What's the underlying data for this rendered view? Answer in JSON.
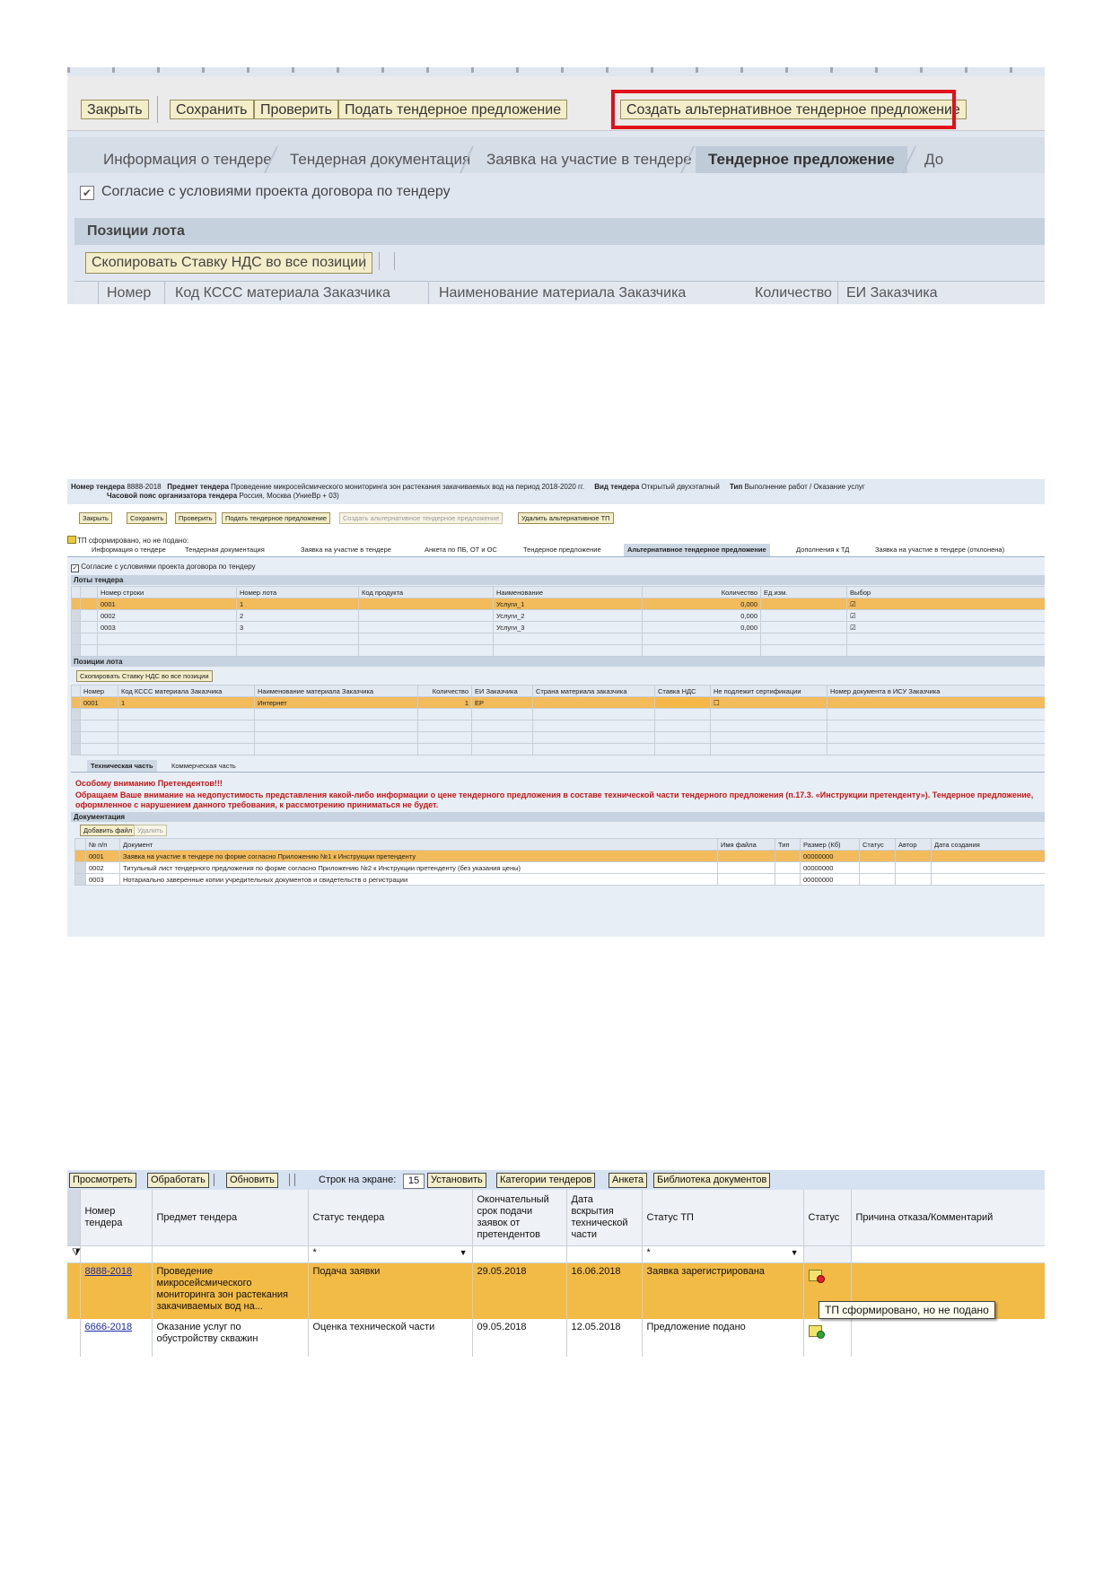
{
  "shot1": {
    "toolbar": {
      "close": "Закрыть",
      "save": "Сохранить",
      "check": "Проверить",
      "submit": "Подать тендерное предложение",
      "create_alt": "Создать альтернативное тендерное предложение"
    },
    "tabs": [
      "Информация о тендере",
      "Тендерная документация",
      "Заявка на участие в тендере",
      "Тендерное предложение",
      "До"
    ],
    "agree_label": "Согласие с условиями проекта договора по тендеру",
    "section_title": "Позиции лота",
    "copy_vat_button": "Скопировать Ставку НДС во все позиции",
    "columns": [
      "Номер",
      "Код КССС материала Заказчика",
      "Наименование материала Заказчика",
      "Количество",
      "ЕИ Заказчика"
    ]
  },
  "shot2": {
    "header": {
      "tender_no_label": "Номер тендера",
      "tender_no": "8888-2018",
      "subject_label": "Предмет тендера",
      "subject": "Проведение микросейсмического мониторинга зон растекания закачиваемых вод на период 2018-2020 гг.",
      "kind_label": "Вид тендера",
      "kind": "Открытый двухэтапный",
      "type_label": "Тип",
      "type": "Выполнение работ / Оказание услуг",
      "tz_label": "Часовой пояс организатора тендера",
      "tz": "Россия, Москва (УниеВр + 03)"
    },
    "toolbar": {
      "close": "Закрыть",
      "save": "Сохранить",
      "check": "Проверить",
      "submit": "Подать тендерное предложение",
      "create_alt": "Создать альтернативное тендерное предложение",
      "delete_alt": "Удалить альтернативное ТП"
    },
    "status_msg": "ТП сформировано, но не подано",
    "tabs": [
      "Информация о тендере",
      "Тендерная документация",
      "Заявка на участие в тендере",
      "Анкета по ПБ, ОТ и ОС",
      "Тендерное предложение",
      "Альтернативное тендерное предложение",
      "Дополнения к ТД",
      "Заявка на участие в тендере (отклонена)"
    ],
    "agree_label": "Согласие с условиями проекта договора по тендеру",
    "lots_title": "Лоты тендера",
    "lots_columns": [
      "Номер строки",
      "Номер лота",
      "Код продукта",
      "Наименование",
      "Количество",
      "Ед.изм.",
      "Выбор"
    ],
    "lots_rows": [
      [
        "0001",
        "1",
        "",
        "Услуги_1",
        "0,000",
        "",
        "☑"
      ],
      [
        "0002",
        "2",
        "",
        "Услуги_2",
        "0,000",
        "",
        "☑"
      ],
      [
        "0003",
        "3",
        "",
        "Услуги_3",
        "0,000",
        "",
        "☑"
      ]
    ],
    "positions_title": "Позиции лота",
    "copy_vat_button": "Скопировать Ставку НДС во все позиции",
    "positions_columns": [
      "Номер",
      "Код КССС материала Заказчика",
      "Наименование материала Заказчика",
      "Количество",
      "ЕИ Заказчика",
      "Страна материала заказчика",
      "Ставка НДС",
      "Не подлежит сертификации",
      "Номер документа в ИСУ Заказчика"
    ],
    "positions_rows": [
      [
        "0001",
        "1",
        "Интернет",
        "1",
        "ЕР",
        "",
        "",
        "☐",
        ""
      ]
    ],
    "subtabs": [
      "Техническая часть",
      "Коммерческая часть"
    ],
    "warning_title": "Особому вниманию Претендентов!!!",
    "warning_text": "Обращаем Ваше внимание на недопустимость представления какой-либо информации о цене тендерного предложения в составе технической части тендерного предложения (п.17.3. «Инструкции претенденту»). Тендерное предложение, оформленное с нарушением данного требования, к рассмотрению приниматься не будет.",
    "docs_title": "Документация",
    "add_file_button": "Добавить файл",
    "delete_button": "Удалить",
    "docs_columns": [
      "№ п/п",
      "Документ",
      "Имя файла",
      "Тип",
      "Размер (Кб)",
      "Статус",
      "Автор",
      "Дата создания"
    ],
    "docs_rows": [
      [
        "0001",
        "Заявка на участие в тендере по форме согласно Приложению №1 к Инструкции претенденту",
        "",
        "",
        "00000000",
        "",
        "",
        ""
      ],
      [
        "0002",
        "Титульный лист тендерного предложения по форме согласно Приложению №2 к Инструкции претенденту (без указания цены)",
        "",
        "",
        "00000000",
        "",
        "",
        ""
      ],
      [
        "0003",
        "Нотариально заверенные копии учредительных документов и свидетельств о регистрации",
        "",
        "",
        "00000000",
        "",
        "",
        ""
      ]
    ]
  },
  "shot3": {
    "toolbar": {
      "view": "Просмотреть",
      "process": "Обработать",
      "refresh": "Обновить",
      "rows_label": "Строк на экране:",
      "rows_value": "15",
      "set": "Установить",
      "categories": "Категории тендеров",
      "survey": "Анкета",
      "library": "Библиотека документов"
    },
    "columns": [
      "Номер тендера",
      "Предмет тендера",
      "Статус тендера",
      "Окончательный срок подачи заявок от претендентов",
      "Дата вскрытия технической части",
      "Статус ТП",
      "Статус",
      "Причина отказа/Комментарий"
    ],
    "filter": {
      "status": "*",
      "tp_status": "*"
    },
    "rows": [
      {
        "no": "8888-2018",
        "subject": "Проведение микросейсмического мониторинга зон растекания закачиваемых вод на...",
        "status": "Подача заявки",
        "deadline": "29.05.2018",
        "open_date": "16.06.2018",
        "tp_status": "Заявка зарегистрирована",
        "icon": "status-red-icon",
        "icon_color": "#e0202a",
        "comment": ""
      },
      {
        "no": "6666-2018",
        "subject": "Оказание услуг по обустройству скважин",
        "status": "Оценка технической части",
        "deadline": "09.05.2018",
        "open_date": "12.05.2018",
        "tp_status": "Предложение подано",
        "icon": "status-green-icon",
        "icon_color": "#2fa53a",
        "comment": ""
      }
    ],
    "tooltip": "ТП сформировано, но не подано"
  },
  "colors": {
    "highlight": "#e0101b",
    "selected_row": "#f2bb45",
    "button_bg": "#f3edc9"
  }
}
